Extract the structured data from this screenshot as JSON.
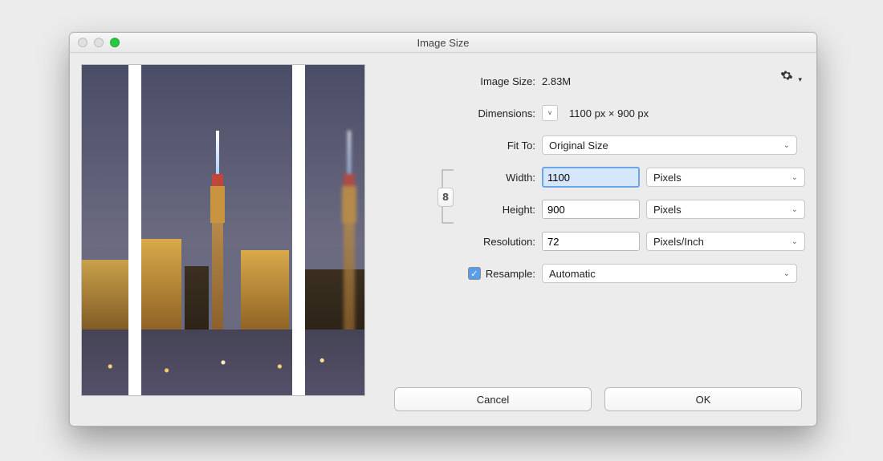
{
  "window": {
    "title": "Image Size"
  },
  "traffic": {
    "close": "#e0e0e0",
    "min": "#e0e0e0",
    "zoom": "#28c840"
  },
  "info": {
    "size_label": "Image Size:",
    "size_value": "2.83M",
    "dim_label": "Dimensions:",
    "dim_value": "1100 px  ×  900 px"
  },
  "fit": {
    "label": "Fit To:",
    "value": "Original Size"
  },
  "width": {
    "label": "Width:",
    "value": "1100",
    "unit": "Pixels"
  },
  "height": {
    "label": "Height:",
    "value": "900",
    "unit": "Pixels"
  },
  "res": {
    "label": "Resolution:",
    "value": "72",
    "unit": "Pixels/Inch"
  },
  "resample": {
    "label": "Resample:",
    "checked": true,
    "value": "Automatic"
  },
  "buttons": {
    "cancel": "Cancel",
    "ok": "OK"
  },
  "icons": {
    "gear": "gear-icon",
    "link": "link-icon",
    "chevron": "chevron-down-icon",
    "dimensions_toggle": "chevron-down-icon"
  }
}
